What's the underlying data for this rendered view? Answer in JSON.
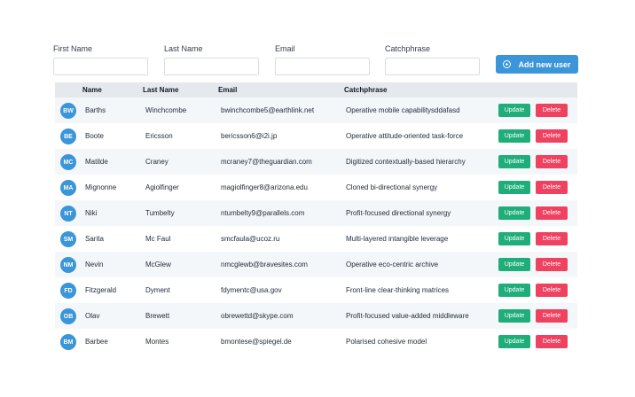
{
  "form": {
    "first_name_label": "First Name",
    "last_name_label": "Last Name",
    "email_label": "Email",
    "catchphrase_label": "Catchphrase",
    "add_button_label": "Add new user",
    "first_name_value": "",
    "last_name_value": "",
    "email_value": "",
    "catchphrase_value": ""
  },
  "table": {
    "headers": [
      "Name",
      "Last Name",
      "Email",
      "Catchphrase"
    ],
    "update_label": "Update",
    "delete_label": "Delete",
    "rows": [
      {
        "initials": "BW",
        "first": "Barths",
        "last": "Winchcombe",
        "email": "bwinchcombe5@earthlink.net",
        "catchphrase": "Operative mobile capabilitysddafasd"
      },
      {
        "initials": "BE",
        "first": "Boote",
        "last": "Ericsson",
        "email": "bericsson6@i2i.jp",
        "catchphrase": "Operative attitude-oriented task-force"
      },
      {
        "initials": "MC",
        "first": "Matilde",
        "last": "Craney",
        "email": "mcraney7@theguardian.com",
        "catchphrase": "Digitized contextually-based hierarchy"
      },
      {
        "initials": "MA",
        "first": "Mignonne",
        "last": "Agiolfinger",
        "email": "magiolfinger8@arizona.edu",
        "catchphrase": "Cloned bi-directional synergy"
      },
      {
        "initials": "NT",
        "first": "Niki",
        "last": "Tumbelty",
        "email": "ntumbelty9@parallels.com",
        "catchphrase": "Profit-focused directional synergy"
      },
      {
        "initials": "SM",
        "first": "Sarita",
        "last": "Mc Faul",
        "email": "smcfaula@ucoz.ru",
        "catchphrase": "Multi-layered intangible leverage"
      },
      {
        "initials": "NM",
        "first": "Nevin",
        "last": "McGlew",
        "email": "nmcglewb@bravesites.com",
        "catchphrase": "Operative eco-centric archive"
      },
      {
        "initials": "FD",
        "first": "Fitzgerald",
        "last": "Dyment",
        "email": "fdymentc@usa.gov",
        "catchphrase": "Front-line clear-thinking matrices"
      },
      {
        "initials": "OB",
        "first": "Olav",
        "last": "Brewett",
        "email": "obrewettd@skype.com",
        "catchphrase": "Profit-focused value-added middleware"
      },
      {
        "initials": "BM",
        "first": "Barbee",
        "last": "Montes",
        "email": "bmontese@spiegel.de",
        "catchphrase": "Polarised cohesive model"
      }
    ]
  },
  "colors": {
    "primary": "#3b95d9",
    "update": "#1fae7a",
    "delete": "#ef4160",
    "header_bg": "#e5e8ec",
    "row_alt": "#f4f7fa"
  }
}
